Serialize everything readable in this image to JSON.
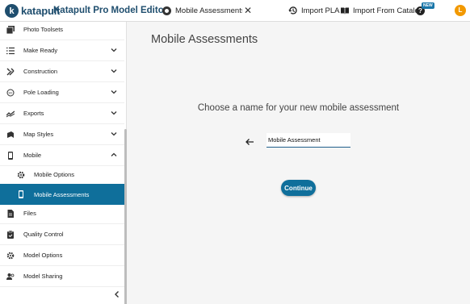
{
  "header": {
    "logo_text": "katapult",
    "logo_mark": "k",
    "app_title": "Katapult Pro Model Editor",
    "document_name": "Mobile Assessments Do",
    "close_glyph": "✕",
    "import_pla_label": "Import PLA",
    "import_catalog_label": "Import From Catalog",
    "help_glyph": "?",
    "new_badge": "NEW",
    "avatar_initial": "L"
  },
  "sidebar": {
    "items": [
      {
        "label": "Photo Toolsets",
        "icon": "photo-toolsets-icon"
      },
      {
        "label": "Make Ready",
        "icon": "list-icon"
      },
      {
        "label": "Construction",
        "icon": "tools-icon"
      },
      {
        "label": "Pole Loading",
        "icon": "3d-rotation-icon"
      },
      {
        "label": "Exports",
        "icon": "trending-icon"
      },
      {
        "label": "Map Styles",
        "icon": "layers-icon"
      },
      {
        "label": "Mobile",
        "icon": "phone-icon"
      },
      {
        "label": "Mobile Options",
        "icon": "gear-icon"
      },
      {
        "label": "Mobile Assessments",
        "icon": "phone-icon"
      },
      {
        "label": "Files",
        "icon": "file-icon"
      },
      {
        "label": "Quality Control",
        "icon": "clipboard-icon"
      },
      {
        "label": "Model Options",
        "icon": "gear-icon"
      },
      {
        "label": "Model Sharing",
        "icon": "people-icon"
      }
    ]
  },
  "main": {
    "title": "Mobile Assessments",
    "prompt": "Choose a name for your new mobile assessment",
    "name_value": "Mobile Assessment",
    "continue_label": "Continue"
  },
  "colors": {
    "accent": "#0f6f9b",
    "brand": "#1f4e6e",
    "avatar": "#f29900"
  }
}
